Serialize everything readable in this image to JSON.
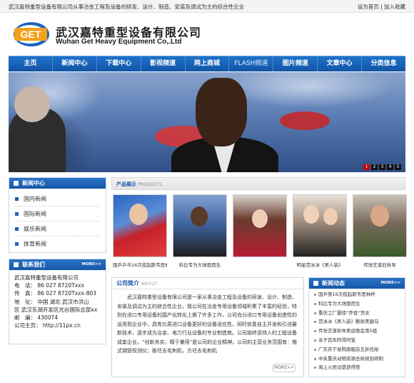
{
  "topbar": {
    "tagline": "武汉嘉特重型设备有限公司从事冶金工程及设备的研发、设计、制造、安装及调试为主的综合性企业",
    "set_home": "设为首页",
    "separator": " | ",
    "add_fav": "加入收藏"
  },
  "brand": {
    "logo_text": "GET",
    "name_cn": "武汉嘉特重型设备有限公司",
    "name_en": "Wuhan Get Heavy Equipment Co,.Ltd",
    "accent": "#1b65bf"
  },
  "nav": [
    "主页",
    "新闻中心",
    "下载中心",
    "影视频道",
    "网上商城",
    "FLASH频道",
    "图片频道",
    "文章中心",
    "分类信息"
  ],
  "banner": {
    "pager": [
      "1",
      "2",
      "3",
      "4",
      "5"
    ],
    "active": 1
  },
  "news_center": {
    "title": "新闻中心",
    "items": [
      "国内新闻",
      "国际新闻",
      "娱乐新闻",
      "体育新闻"
    ]
  },
  "contact": {
    "title": "联系我们",
    "more": "MORE>>",
    "lines": [
      "武汉嘉特重型设备有限公司",
      "电　话：  86 027 8720Txxx",
      "传　真：  86 027 8720Txxx-803",
      "地　址：  中国  湖北  武汉市洪山",
      "区  武汉东湖开发区光谷国际总部xx",
      "邮　编：  430074",
      "公司主页：  http://11px.cn"
    ]
  },
  "products": {
    "title": "产品展示",
    "subtitle": "PRODUCTS",
    "items": [
      "国乒乒乓16次揽起斯韦思林",
      "科比专为大球面而生",
      "",
      "明星范冰冰《男人装》",
      "传张艺谋旧执导"
    ]
  },
  "about": {
    "title": "公司简介",
    "subtitle": "ABOUT",
    "text": "武汉嘉特重型设备有限公司是一家从事冶金工程及设备的研发、设计、制造、安装及调试为主的综合性企业，我公司在冶金专用设备领域积累了丰富的经验，特别在进口专用设备的国产化转化上做了许多工作，公司充分进口专用设备创造性的运用到企业中，具有比原进口设备更好的设备适应性，同时依靠自主开发和引进最新技术，逐步成为冶金、电力行业设备的专业制造商。公司始终坚持人的工程设备成套企业。“创新务实，精于兼用”是公司的企业精神。公司的主营业务范围有：推式钢管校测仪；板坯去毛刺机，方坯去毛刺机",
    "more": "MORE>>"
  },
  "hot": {
    "title": "新闻动态",
    "more": "MORE>>",
    "items": [
      "国乒第16次揽起斯韦思林杯",
      "科比专为大场面而生",
      "重庆工厂震惊“乔登”宫女",
      "范冰冰《男人装》删除美腿勾",
      "传张艺谋执导奥运晚会落5组",
      "亲子百年阿哥阿宝",
      "广东苏宁易购旗舰店五折优抢",
      "中央重庆动物资源总局规划研制",
      "海上火炬功堡获得赞"
    ]
  }
}
